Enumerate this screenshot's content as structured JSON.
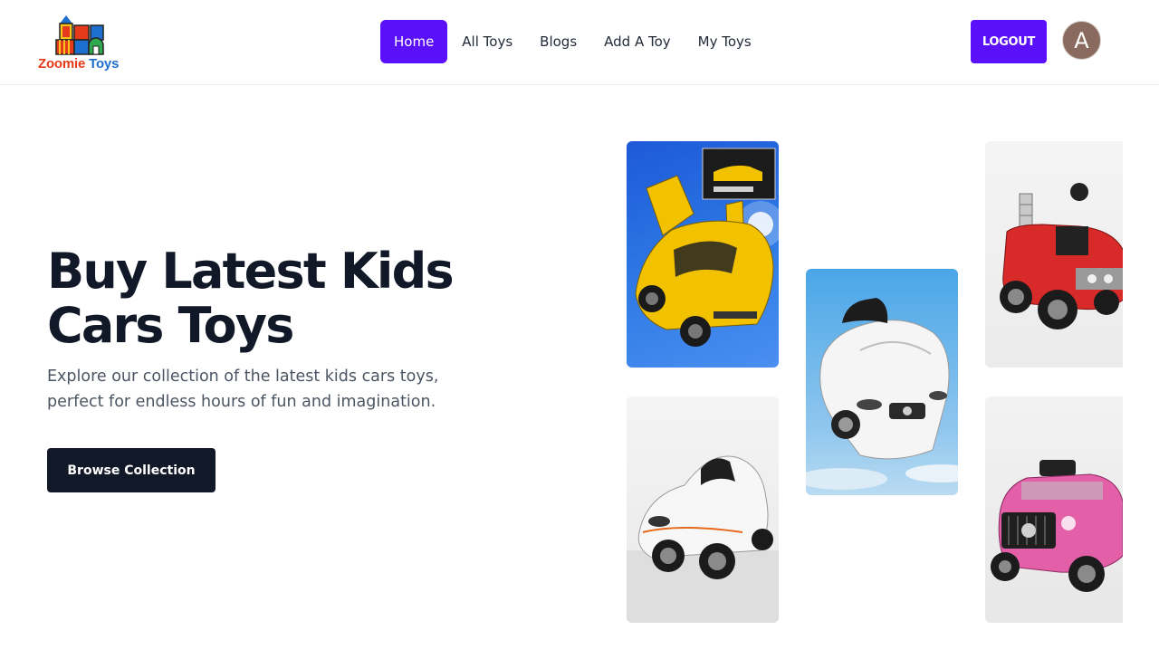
{
  "brand": {
    "word1": "Zoomie",
    "word2": "Toys",
    "word1_color": "#e63b1a",
    "word2_color": "#1f6fcf"
  },
  "nav": {
    "items": [
      {
        "label": "Home",
        "active": true
      },
      {
        "label": "All Toys",
        "active": false
      },
      {
        "label": "Blogs",
        "active": false
      },
      {
        "label": "Add A Toy",
        "active": false
      },
      {
        "label": "My Toys",
        "active": false
      }
    ],
    "accent_color": "#5a10f8"
  },
  "user": {
    "logout_label": "LOGOUT",
    "avatar_initial": "A"
  },
  "hero": {
    "title_line1": "Buy Latest Kids",
    "title_line2": "Cars Toys",
    "description": "Explore our collection of the latest kids cars toys, perfect for endless hours of fun and imagination.",
    "cta_label": "Browse Collection"
  },
  "gallery": {
    "images": [
      {
        "name": "yellow-sports-car-toy"
      },
      {
        "name": "white-ride-on-sports-car"
      },
      {
        "name": "white-mercedes-ride-on-car"
      },
      {
        "name": "red-fire-truck-ride-on"
      },
      {
        "name": "pink-jeep-ride-on"
      }
    ]
  }
}
